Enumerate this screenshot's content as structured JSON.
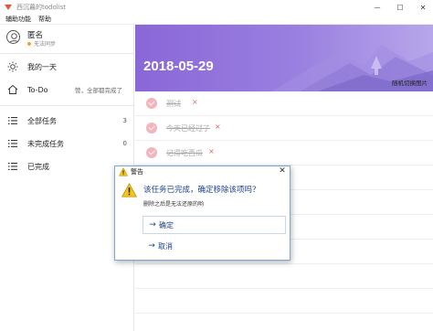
{
  "window": {
    "title": "西沉暮的todolist",
    "controls": {
      "minimize": "—",
      "maximize": "☐",
      "close": "✕"
    }
  },
  "menu": [
    "辅助功能",
    "帮助"
  ],
  "user": {
    "name": "匿名",
    "status": "无法同步"
  },
  "nav": {
    "my_day": {
      "label": "我的一天"
    },
    "todo": {
      "label": "To-Do",
      "note": "赞，全部都完成了"
    },
    "all": {
      "label": "全部任务",
      "count": "3"
    },
    "unfinished": {
      "label": "未完成任务",
      "count": "0"
    },
    "finished": {
      "label": "已完成"
    }
  },
  "banner": {
    "date": "2018-05-29",
    "random_image_label": "随机切换图片"
  },
  "tasks": [
    {
      "label": "测试",
      "delete": "×"
    },
    {
      "label": "今天已经过了",
      "delete": "×"
    },
    {
      "label": "记得吃西瓜",
      "delete": "×"
    }
  ],
  "dialog": {
    "title": "警告",
    "close": "✕",
    "message": "该任务已完成，确定移除该项吗？",
    "sub": "删除之后是无法还原的哟",
    "confirm": "确定",
    "cancel": "取消",
    "arrow": "→"
  },
  "colors": {
    "accent": "#8a67d8",
    "check": "#f5b4bd",
    "link": "#1a3f8f"
  }
}
